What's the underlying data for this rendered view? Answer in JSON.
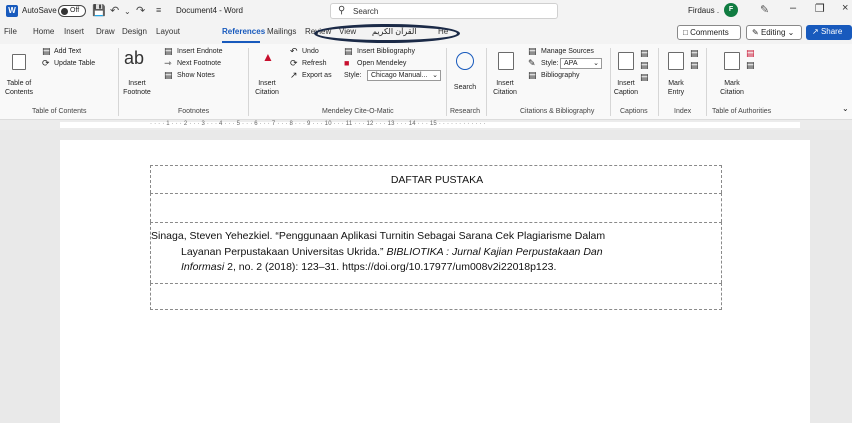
{
  "titlebar": {
    "autosave_label": "AutoSave",
    "autosave_state": "Off",
    "doc_title": "Document4 - Word",
    "search_placeholder": "Search",
    "user_name": "Firdaus .",
    "avatar_initial": "F"
  },
  "menu": {
    "tabs": [
      "File",
      "Home",
      "Insert",
      "Draw",
      "Design",
      "Layout",
      "References",
      "Mailings",
      "Review",
      "View",
      "القرآن الكريم",
      "He"
    ],
    "active_tab": "References",
    "comments_label": "Comments",
    "editing_label": "Editing",
    "share_label": "Share"
  },
  "ribbon": {
    "toc": {
      "table_of_contents": "Table of",
      "contents": "Contents",
      "add_text": "Add Text",
      "update_table": "Update Table",
      "group_label": "Table of Contents"
    },
    "footnotes": {
      "insert": "Insert",
      "footnote": "Footnote",
      "insert_endnote": "Insert Endnote",
      "next_footnote": "Next Footnote",
      "show_notes": "Show Notes",
      "group_label": "Footnotes"
    },
    "mendeley": {
      "insert": "Insert",
      "citation": "Citation",
      "undo": "Undo",
      "refresh": "Refresh",
      "export_as": "Export as",
      "insert_bibliography": "Insert Bibliography",
      "open_mendeley": "Open Mendeley",
      "style_label": "Style:",
      "style_value": "Chicago Manual...",
      "group_label": "Mendeley Cite-O-Matic"
    },
    "research": {
      "search": "Search",
      "group_label": "Research"
    },
    "citations": {
      "insert": "Insert",
      "citation": "Citation",
      "manage_sources": "Manage Sources",
      "style_label": "Style:",
      "style_value": "APA",
      "bibliography": "Bibliography",
      "group_label": "Citations & Bibliography"
    },
    "captions": {
      "insert": "Insert",
      "caption": "Caption",
      "group_label": "Captions"
    },
    "index": {
      "mark": "Mark",
      "entry": "Entry",
      "group_label": "Index"
    },
    "authorities": {
      "mark": "Mark",
      "citation": "Citation",
      "group_label": "Table of Authorities"
    }
  },
  "ruler": {
    "text": "· · · · 1 · · · 2 · · · 3 · · · 4 · · · 5 · · · 6 · · · 7 · · · 8 · · · 9 · · · 10 · · · 11 · · · 12 · · · 13 · · · 14 · · · 15 · · · · · · · · · · · ·"
  },
  "document": {
    "heading": "DAFTAR PUSTAKA",
    "ref_line1": "Sinaga, Steven Yehezkiel. “Penggunaan Aplikasi Turnitin Sebagai Sarana Cek Plagiarisme Dalam",
    "ref_line2_plain": "Layanan Perpustakaan Universitas Ukrida.” ",
    "ref_line2_italic": "BIBLIOTIKA : Jurnal Kajian Perpustakaan Dan",
    "ref_line3_italic": "Informasi",
    "ref_line3_plain": " 2, no. 2 (2018): 123–31. https://doi.org/10.17977/um008v2i22018p123."
  },
  "colors": {
    "accent": "#185abd",
    "avatar": "#107c41",
    "oval": "#1b2a47"
  }
}
